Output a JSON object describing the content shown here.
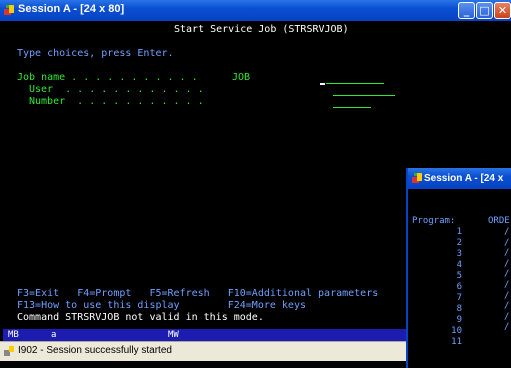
{
  "main": {
    "window_title": "Session A - [24 x 80]",
    "screen_title": "Start Service Job (STRSRVJOB)",
    "instructions": "Type choices, press Enter.",
    "fields": [
      {
        "label": "Job name . . . . . . . . . . .",
        "value": "JOB"
      },
      {
        "label": "User  . . . . . . . . . . . .",
        "value": ""
      },
      {
        "label": "Number  . . . . . . . . . . .",
        "value": ""
      }
    ],
    "fkeys_line1": "F3=Exit   F4=Prompt   F5=Refresh   F10=Additional parameters",
    "fkeys_line2": "F13=How to use this display        F24=More keys",
    "message": "Command STRSRVJOB not valid in this mode.",
    "oia": {
      "left": "MB",
      "a": "a",
      "mw": "MW"
    },
    "status_message": "I902 - Session successfully started"
  },
  "second_window": {
    "window_title": "Session A - [24 x",
    "program_label": "Program:",
    "program_value": "ORDE",
    "rows": [
      "1",
      "2",
      "3",
      "4",
      "5",
      "6",
      "7",
      "8",
      "9",
      "10",
      "11"
    ]
  },
  "colors": {
    "field_green": "#2ee82e",
    "title_white": "#ffffff",
    "titlebar_blue": "#0843c3"
  }
}
